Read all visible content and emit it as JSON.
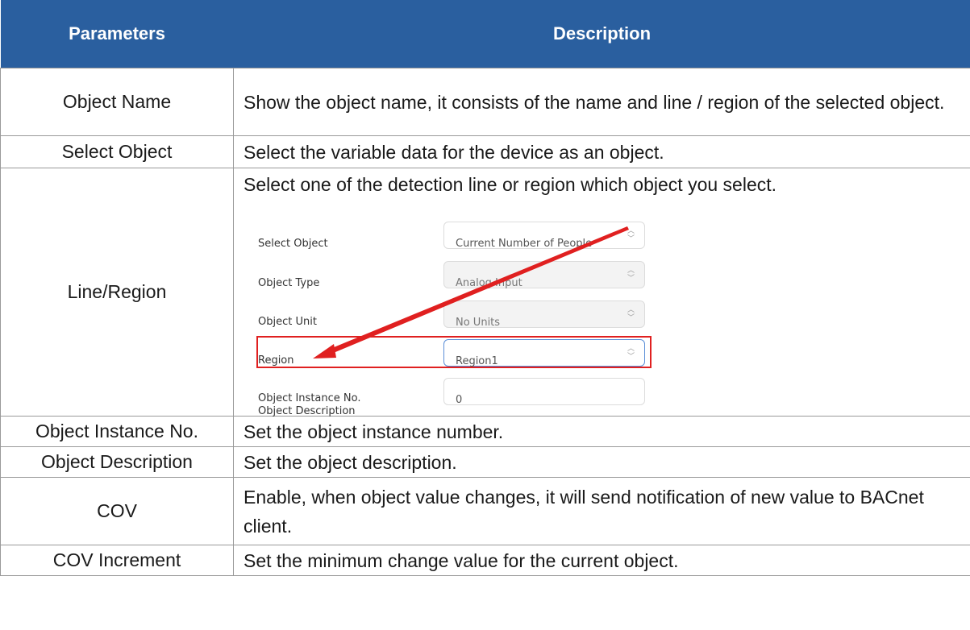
{
  "table": {
    "header": {
      "parameters": "Parameters",
      "description": "Description"
    },
    "rows": [
      {
        "param": "Object Name",
        "desc": "Show the object name, it consists of the name and line / region of the selected object."
      },
      {
        "param": "Select Object",
        "desc": "Select the variable data for the device as an object."
      },
      {
        "param": "Line/Region",
        "desc": "Select one of the detection line or region which object you select."
      },
      {
        "param": "Object Instance No.",
        "desc": "Set the object instance number."
      },
      {
        "param": "Object Description",
        "desc": "Set the object description."
      },
      {
        "param": "COV",
        "desc": "Enable, when object value changes, it will send notification of new value to BACnet client."
      },
      {
        "param": "COV Increment",
        "desc": "Set the minimum change value for the current object."
      }
    ]
  },
  "embedded_form": {
    "fields": [
      {
        "label": "Select Object",
        "value": "Current Number of People"
      },
      {
        "label": "Object Type",
        "value": "Analog Input"
      },
      {
        "label": "Object Unit",
        "value": "No Units"
      },
      {
        "label": "Region",
        "value": "Region1"
      },
      {
        "label": "Object Instance No.",
        "value": "0"
      },
      {
        "label": "Object Description",
        "value": ""
      }
    ],
    "highlight_color": "#e02020"
  },
  "colors": {
    "header_bg": "#2a5f9f",
    "header_text": "#ffffff",
    "border": "#9a9a9a"
  }
}
